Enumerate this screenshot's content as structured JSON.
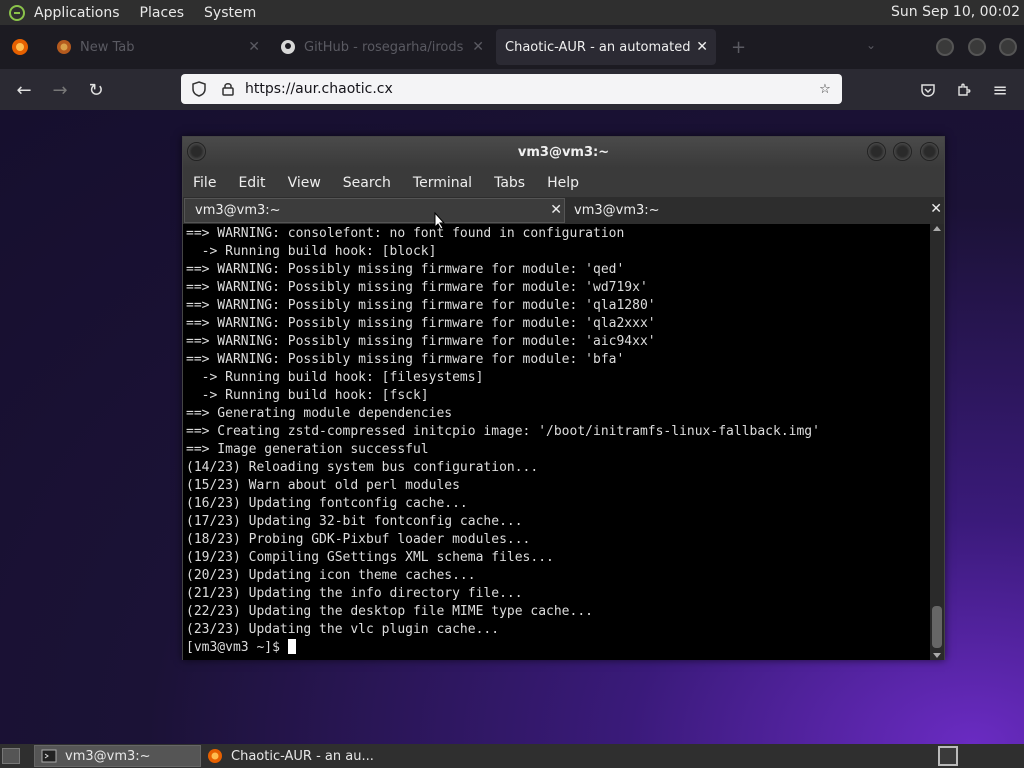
{
  "top_panel": {
    "menus": [
      "Applications",
      "Places",
      "System"
    ],
    "clock": "Sun Sep 10, 00:02"
  },
  "browser": {
    "tabs": [
      {
        "title": "New Tab",
        "active": false
      },
      {
        "title": "GitHub - rosegarha/irods",
        "active": false
      },
      {
        "title": "Chaotic-AUR - an automated bu",
        "active": true
      }
    ],
    "new_tab_icon": "plus-icon",
    "url": "https://aur.chaotic.cx"
  },
  "terminal": {
    "title": "vm3@vm3:~",
    "menu": [
      "File",
      "Edit",
      "View",
      "Search",
      "Terminal",
      "Tabs",
      "Help"
    ],
    "tabs": [
      {
        "title": "vm3@vm3:~",
        "active": true
      },
      {
        "title": "vm3@vm3:~",
        "active": false
      }
    ],
    "lines": [
      "==> WARNING: consolefont: no font found in configuration",
      "  -> Running build hook: [block]",
      "==> WARNING: Possibly missing firmware for module: 'qed'",
      "==> WARNING: Possibly missing firmware for module: 'wd719x'",
      "==> WARNING: Possibly missing firmware for module: 'qla1280'",
      "==> WARNING: Possibly missing firmware for module: 'qla2xxx'",
      "==> WARNING: Possibly missing firmware for module: 'aic94xx'",
      "==> WARNING: Possibly missing firmware for module: 'bfa'",
      "  -> Running build hook: [filesystems]",
      "  -> Running build hook: [fsck]",
      "==> Generating module dependencies",
      "==> Creating zstd-compressed initcpio image: '/boot/initramfs-linux-fallback.img'",
      "==> Image generation successful",
      "(14/23) Reloading system bus configuration...",
      "(15/23) Warn about old perl modules",
      "(16/23) Updating fontconfig cache...",
      "(17/23) Updating 32-bit fontconfig cache...",
      "(18/23) Probing GDK-Pixbuf loader modules...",
      "(19/23) Compiling GSettings XML schema files...",
      "(20/23) Updating icon theme caches...",
      "(21/23) Updating the info directory file...",
      "(22/23) Updating the desktop file MIME type cache...",
      "(23/23) Updating the vlc plugin cache..."
    ],
    "prompt": "[vm3@vm3 ~]$ "
  },
  "taskbar": {
    "items": [
      {
        "label": "vm3@vm3:~",
        "icon": "terminal-icon",
        "active": true
      },
      {
        "label": "Chaotic-AUR - an au...",
        "icon": "firefox-icon",
        "active": false
      }
    ]
  }
}
